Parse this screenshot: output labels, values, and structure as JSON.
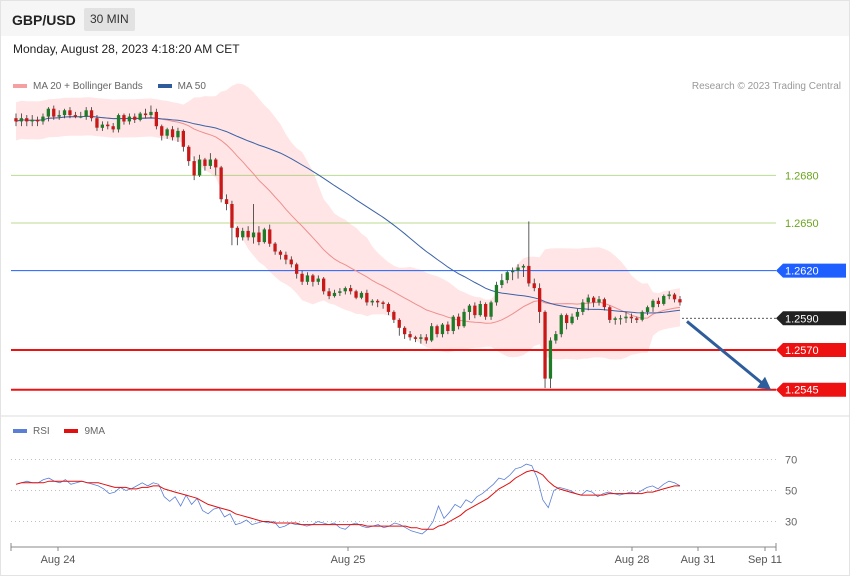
{
  "header": {
    "symbol": "GBP/USD",
    "timeframe": "30 MIN",
    "datetime": "Monday, August 28, 2023 4:18:20 AM CET"
  },
  "legend": {
    "price": [
      {
        "label": "MA 20 + Bollinger Bands",
        "color": "#f08080"
      },
      {
        "label": "MA 50",
        "color": "#2f5b9b"
      }
    ],
    "rsi": [
      {
        "label": "RSI",
        "color": "#5b7fd6"
      },
      {
        "label": "9MA",
        "color": "#e01010"
      }
    ]
  },
  "credit": "Research © 2023 Trading Central",
  "chart_data": [
    {
      "type": "candlestick",
      "title": "GBP/USD 30 MIN",
      "ylim": [
        1.2536,
        1.273
      ],
      "x_ticks": [
        "Aug 24",
        "Aug 25",
        "Aug 28",
        "Aug 31",
        "Sep 11"
      ],
      "levels": [
        {
          "value": 1.268,
          "label": "1.2680",
          "kind": "resistance",
          "color": "#8bc34a"
        },
        {
          "value": 1.265,
          "label": "1.2650",
          "kind": "resistance",
          "color": "#8bc34a"
        },
        {
          "value": 1.262,
          "label": "1.2620",
          "kind": "pivot",
          "color": "#1f5fff"
        },
        {
          "value": 1.259,
          "label": "1.2590",
          "kind": "last",
          "color": "#222222"
        },
        {
          "value": 1.257,
          "label": "1.2570",
          "kind": "support",
          "color": "#ee1111"
        },
        {
          "value": 1.2545,
          "label": "1.2545",
          "kind": "support",
          "color": "#ee1111"
        }
      ],
      "projection": {
        "from": 1.2588,
        "to": 1.2545,
        "color": "#2e5d9c"
      },
      "candles": [
        [
          1.2716,
          1.2714,
          1.2719,
          1.2711
        ],
        [
          1.2714,
          1.2716,
          1.2719,
          1.2711
        ],
        [
          1.2716,
          1.2714,
          1.2718,
          1.2711
        ],
        [
          1.2714,
          1.2715,
          1.2718,
          1.2711
        ],
        [
          1.2715,
          1.2714,
          1.2717,
          1.2711
        ],
        [
          1.2714,
          1.2717,
          1.2719,
          1.2712
        ],
        [
          1.2717,
          1.2722,
          1.2723,
          1.2714
        ],
        [
          1.2722,
          1.2717,
          1.2724,
          1.2715
        ],
        [
          1.2717,
          1.2718,
          1.2721,
          1.2715
        ],
        [
          1.2718,
          1.2721,
          1.2722,
          1.2716
        ],
        [
          1.2721,
          1.2718,
          1.2723,
          1.2716
        ],
        [
          1.2718,
          1.2717,
          1.272,
          1.2716
        ],
        [
          1.2717,
          1.2717,
          1.272,
          1.2716
        ],
        [
          1.2717,
          1.2721,
          1.2723,
          1.2715
        ],
        [
          1.2721,
          1.2716,
          1.2723,
          1.2714
        ],
        [
          1.2716,
          1.271,
          1.2718,
          1.2708
        ],
        [
          1.271,
          1.2712,
          1.2714,
          1.2708
        ],
        [
          1.2712,
          1.2711,
          1.2714,
          1.2709
        ],
        [
          1.2711,
          1.2709,
          1.2713,
          1.2707
        ],
        [
          1.2709,
          1.2718,
          1.2719,
          1.2707
        ],
        [
          1.2718,
          1.2714,
          1.2719,
          1.2712
        ],
        [
          1.2714,
          1.2717,
          1.2719,
          1.2712
        ],
        [
          1.2717,
          1.2715,
          1.2719,
          1.2713
        ],
        [
          1.2715,
          1.2719,
          1.272,
          1.2714
        ],
        [
          1.2719,
          1.2718,
          1.2722,
          1.2716
        ],
        [
          1.2718,
          1.272,
          1.2724,
          1.2716
        ],
        [
          1.272,
          1.2711,
          1.2722,
          1.2709
        ],
        [
          1.2711,
          1.2705,
          1.2712,
          1.2702
        ],
        [
          1.2705,
          1.2709,
          1.271,
          1.2703
        ],
        [
          1.2709,
          1.2704,
          1.2711,
          1.2702
        ],
        [
          1.2704,
          1.2708,
          1.271,
          1.2701
        ],
        [
          1.2708,
          1.2698,
          1.2709,
          1.2695
        ],
        [
          1.2698,
          1.2689,
          1.2699,
          1.2686
        ],
        [
          1.2689,
          1.268,
          1.2692,
          1.2677
        ],
        [
          1.268,
          1.269,
          1.2693,
          1.2679
        ],
        [
          1.269,
          1.2686,
          1.2691,
          1.2683
        ],
        [
          1.2686,
          1.269,
          1.2694,
          1.2684
        ],
        [
          1.269,
          1.2685,
          1.2691,
          1.268
        ],
        [
          1.2685,
          1.2665,
          1.2686,
          1.2663
        ],
        [
          1.2665,
          1.2662,
          1.2668,
          1.2658
        ],
        [
          1.2662,
          1.2647,
          1.2664,
          1.2636
        ],
        [
          1.2647,
          1.2641,
          1.2648,
          1.2636
        ],
        [
          1.2641,
          1.2645,
          1.2647,
          1.2639
        ],
        [
          1.2645,
          1.2641,
          1.2648,
          1.2639
        ],
        [
          1.2641,
          1.2644,
          1.2662,
          1.2637
        ],
        [
          1.2644,
          1.2638,
          1.2648,
          1.2636
        ],
        [
          1.2638,
          1.2646,
          1.2647,
          1.2637
        ],
        [
          1.2646,
          1.2637,
          1.2649,
          1.2635
        ],
        [
          1.2637,
          1.2632,
          1.2638,
          1.263
        ],
        [
          1.2632,
          1.263,
          1.2633,
          1.2627
        ],
        [
          1.263,
          1.2627,
          1.2632,
          1.2624
        ],
        [
          1.2627,
          1.2624,
          1.2629,
          1.2622
        ],
        [
          1.2624,
          1.2618,
          1.2625,
          1.2615
        ],
        [
          1.2618,
          1.2613,
          1.262,
          1.2611
        ],
        [
          1.2613,
          1.2617,
          1.2619,
          1.2611
        ],
        [
          1.2617,
          1.2613,
          1.2618,
          1.261
        ],
        [
          1.2613,
          1.2615,
          1.2617,
          1.2611
        ],
        [
          1.2615,
          1.2607,
          1.2616,
          1.2605
        ],
        [
          1.2607,
          1.2604,
          1.2609,
          1.2602
        ],
        [
          1.2604,
          1.2606,
          1.2608,
          1.2603
        ],
        [
          1.2606,
          1.2607,
          1.2609,
          1.2604
        ],
        [
          1.2607,
          1.2609,
          1.261,
          1.2605
        ],
        [
          1.2609,
          1.2607,
          1.2611,
          1.2605
        ],
        [
          1.2607,
          1.2603,
          1.2608,
          1.2602
        ],
        [
          1.2603,
          1.2606,
          1.2607,
          1.2602
        ],
        [
          1.2606,
          1.26,
          1.2608,
          1.2598
        ],
        [
          1.26,
          1.2601,
          1.2602,
          1.2598
        ],
        [
          1.2601,
          1.26,
          1.2602,
          1.2597
        ],
        [
          1.26,
          1.2599,
          1.2601,
          1.2596
        ],
        [
          1.2599,
          1.2594,
          1.26,
          1.2592
        ],
        [
          1.2594,
          1.2589,
          1.2595,
          1.2587
        ],
        [
          1.2589,
          1.2584,
          1.259,
          1.2579
        ],
        [
          1.2584,
          1.258,
          1.2585,
          1.2577
        ],
        [
          1.258,
          1.2578,
          1.2582,
          1.2576
        ],
        [
          1.2578,
          1.2577,
          1.2579,
          1.2575
        ],
        [
          1.2577,
          1.2578,
          1.258,
          1.2574
        ],
        [
          1.2578,
          1.2576,
          1.258,
          1.2574
        ],
        [
          1.2576,
          1.2585,
          1.2587,
          1.2575
        ],
        [
          1.2585,
          1.258,
          1.2586,
          1.2578
        ],
        [
          1.258,
          1.2586,
          1.2587,
          1.2578
        ],
        [
          1.2586,
          1.2582,
          1.2588,
          1.258
        ],
        [
          1.2582,
          1.2591,
          1.2592,
          1.258
        ],
        [
          1.2591,
          1.2585,
          1.2593,
          1.2583
        ],
        [
          1.2585,
          1.2594,
          1.2596,
          1.2584
        ],
        [
          1.2594,
          1.2598,
          1.2599,
          1.2589
        ],
        [
          1.2598,
          1.2592,
          1.26,
          1.259
        ],
        [
          1.2592,
          1.2599,
          1.2601,
          1.2591
        ],
        [
          1.2599,
          1.2591,
          1.26,
          1.2589
        ],
        [
          1.2591,
          1.26,
          1.2601,
          1.2589
        ],
        [
          1.26,
          1.2611,
          1.2613,
          1.2598
        ],
        [
          1.2611,
          1.2614,
          1.2618,
          1.2609
        ],
        [
          1.2614,
          1.2619,
          1.262,
          1.2612
        ],
        [
          1.2619,
          1.262,
          1.2622,
          1.2614
        ],
        [
          1.262,
          1.2622,
          1.2624,
          1.2615
        ],
        [
          1.2622,
          1.2623,
          1.2624,
          1.2616
        ],
        [
          1.2623,
          1.2612,
          1.2651,
          1.261
        ],
        [
          1.2612,
          1.2609,
          1.2615,
          1.2607
        ],
        [
          1.2609,
          1.2594,
          1.2612,
          1.2587
        ],
        [
          1.2594,
          1.2552,
          1.2595,
          1.2546
        ],
        [
          1.2552,
          1.2576,
          1.2578,
          1.2546
        ],
        [
          1.2576,
          1.258,
          1.2582,
          1.2574
        ],
        [
          1.258,
          1.2592,
          1.2593,
          1.2578
        ],
        [
          1.2592,
          1.2587,
          1.2593,
          1.2583
        ],
        [
          1.2587,
          1.2591,
          1.2593,
          1.2586
        ],
        [
          1.2591,
          1.2594,
          1.2596,
          1.2589
        ],
        [
          1.2594,
          1.26,
          1.2602,
          1.2592
        ],
        [
          1.26,
          1.2603,
          1.2605,
          1.2595
        ],
        [
          1.2603,
          1.26,
          1.2604,
          1.2597
        ],
        [
          1.26,
          1.2602,
          1.2604,
          1.2598
        ],
        [
          1.2602,
          1.2597,
          1.2603,
          1.2595
        ],
        [
          1.2597,
          1.2589,
          1.2598,
          1.2587
        ],
        [
          1.2589,
          1.259,
          1.2591,
          1.2586
        ],
        [
          1.259,
          1.259,
          1.2592,
          1.2586
        ],
        [
          1.259,
          1.2591,
          1.2594,
          1.2587
        ],
        [
          1.2591,
          1.259,
          1.2593,
          1.2587
        ],
        [
          1.259,
          1.2589,
          1.2591,
          1.2587
        ],
        [
          1.2589,
          1.2594,
          1.2595,
          1.2588
        ],
        [
          1.2594,
          1.2597,
          1.2598,
          1.2592
        ],
        [
          1.2597,
          1.2601,
          1.2602,
          1.2594
        ],
        [
          1.2601,
          1.2599,
          1.2603,
          1.2597
        ],
        [
          1.2599,
          1.2604,
          1.2605,
          1.2598
        ],
        [
          1.2604,
          1.2605,
          1.2607,
          1.2602
        ],
        [
          1.2605,
          1.2602,
          1.2606,
          1.26
        ],
        [
          1.2602,
          1.26,
          1.2604,
          1.2598
        ]
      ]
    },
    {
      "type": "line",
      "title": "",
      "ylim": [
        20,
        80
      ],
      "y_ticks": [
        70,
        50,
        30
      ],
      "series": [
        {
          "name": "RSI",
          "color": "#5b7fd6",
          "values": [
            54,
            55,
            56,
            55,
            55,
            57,
            58,
            56,
            55,
            57,
            54,
            55,
            56,
            55,
            54,
            53,
            51,
            48,
            49,
            52,
            50,
            51,
            53,
            55,
            53,
            55,
            54,
            46,
            43,
            46,
            40,
            47,
            41,
            45,
            37,
            35,
            38,
            39,
            33,
            35,
            28,
            29,
            31,
            28,
            29,
            30,
            29,
            30,
            26,
            27,
            29,
            28,
            28,
            27,
            28,
            30,
            29,
            28,
            29,
            26,
            25,
            28,
            29,
            27,
            26,
            27,
            28,
            26,
            27,
            29,
            28,
            26,
            24,
            23,
            22,
            25,
            30,
            40,
            32,
            36,
            41,
            39,
            44,
            42,
            46,
            48,
            51,
            54,
            58,
            57,
            60,
            64,
            65,
            67,
            66,
            58,
            44,
            39,
            50,
            52,
            51,
            50,
            48,
            47,
            50,
            49,
            46,
            48,
            49,
            48,
            47,
            48,
            49,
            48,
            50,
            52,
            53,
            51,
            54,
            56,
            55,
            53
          ]
        },
        {
          "name": "9MA",
          "color": "#e01010",
          "values": [
            54,
            55,
            55,
            55,
            55,
            55,
            56,
            56,
            56,
            56,
            56,
            56,
            56,
            55,
            55,
            55,
            54,
            53,
            52,
            52,
            52,
            51,
            51,
            52,
            52,
            53,
            53,
            51,
            50,
            49,
            48,
            47,
            46,
            45,
            43,
            41,
            40,
            39,
            38,
            37,
            35,
            34,
            33,
            32,
            31,
            30,
            30,
            29,
            29,
            29,
            29,
            29,
            28,
            28,
            28,
            28,
            28,
            28,
            28,
            28,
            28,
            28,
            28,
            28,
            27,
            27,
            27,
            27,
            27,
            27,
            27,
            27,
            26,
            26,
            25,
            25,
            25,
            27,
            28,
            30,
            32,
            34,
            37,
            39,
            41,
            43,
            45,
            48,
            51,
            53,
            55,
            58,
            60,
            62,
            63,
            62,
            60,
            56,
            53,
            51,
            50,
            49,
            48,
            47,
            47,
            47,
            47,
            47,
            48,
            48,
            48,
            48,
            48,
            48,
            48,
            49,
            49,
            50,
            51,
            52,
            53,
            53
          ]
        }
      ]
    }
  ]
}
